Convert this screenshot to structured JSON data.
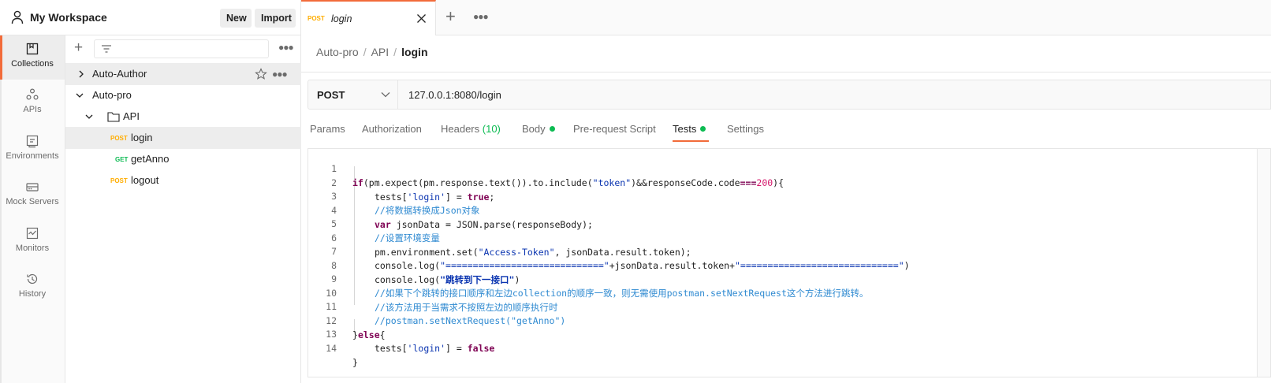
{
  "workspace": {
    "title": "My Workspace",
    "new_label": "New",
    "import_label": "Import",
    "user_icon": "person-icon"
  },
  "sidebar": {
    "items": [
      {
        "label": "Collections",
        "icon": "collections-icon",
        "active": true
      },
      {
        "label": "APIs",
        "icon": "apis-icon",
        "active": false
      },
      {
        "label": "Environments",
        "icon": "environments-icon",
        "active": false
      },
      {
        "label": "Mock Servers",
        "icon": "mock-servers-icon",
        "active": false
      },
      {
        "label": "Monitors",
        "icon": "monitors-icon",
        "active": false
      },
      {
        "label": "History",
        "icon": "history-icon",
        "active": false
      }
    ]
  },
  "collections": {
    "tree": [
      {
        "label": "Auto-Author",
        "kind": "collection",
        "expanded": false
      },
      {
        "label": "Auto-pro",
        "kind": "collection",
        "expanded": true
      },
      {
        "label": "API",
        "kind": "folder",
        "expanded": true
      },
      {
        "label": "login",
        "kind": "request",
        "method": "POST",
        "selected": true
      },
      {
        "label": "getAnno",
        "kind": "request",
        "method": "GET"
      },
      {
        "label": "logout",
        "kind": "request",
        "method": "POST"
      }
    ]
  },
  "tab": {
    "method": "POST",
    "title": "login"
  },
  "breadcrumb": {
    "items": [
      "Auto-pro",
      "API",
      "login"
    ],
    "separator": "/"
  },
  "request": {
    "method": "POST",
    "url": "127.0.0.1:8080/login"
  },
  "request_tabs": [
    {
      "label": "Params"
    },
    {
      "label": "Authorization"
    },
    {
      "label": "Headers",
      "count": "(10)"
    },
    {
      "label": "Body",
      "dot": true
    },
    {
      "label": "Pre-request Script"
    },
    {
      "label": "Tests",
      "dot": true,
      "active": true
    },
    {
      "label": "Settings"
    }
  ],
  "editor": {
    "lines": [
      "1",
      "2",
      "3",
      "4",
      "5",
      "6",
      "7",
      "8",
      "9",
      "10",
      "11",
      "12",
      "13",
      "14"
    ],
    "code": {
      "l1_a": "if",
      "l1_b": "(pm.expect(pm.response.text()).to.include(",
      "l1_c": "\"token\"",
      "l1_d": ")&&responseCode.code",
      "l1_e": "===",
      "l1_f": "200",
      "l1_g": "){",
      "l2_a": "tests[",
      "l2_b": "'login'",
      "l2_c": "] = ",
      "l2_d": "true",
      "l2_e": ";",
      "l3": "//将数据转换成Json对象",
      "l4_a": "var",
      "l4_b": " jsonData = JSON.parse(responseBody);",
      "l5": "//设置环境变量",
      "l6_a": "pm.environment.set(",
      "l6_b": "\"Access-Token\"",
      "l6_c": ", jsonData.result.token);",
      "l7_a": "console.log(",
      "l7_b": "\"=============================\"",
      "l7_c": "+jsonData.result.token+",
      "l7_d": "\"=============================\"",
      "l7_e": ")",
      "l8_a": "console.log(",
      "l8_b": "\"跳转到下一接口\"",
      "l8_c": ")",
      "l9": "//如果下个跳转的接口顺序和左边collection的顺序一致，则无需使用postman.setNextRequest这个方法进行跳转。",
      "l10": "//该方法用于当需求不按照左边的顺序执行时",
      "l11": "//postman.setNextRequest(\"getAnno\")",
      "l12_a": "}",
      "l12_b": "else",
      "l12_c": "{",
      "l13_a": "tests[",
      "l13_b": "'login'",
      "l13_c": "] = ",
      "l13_d": "false",
      "l14": "}"
    }
  },
  "colors": {
    "accent": "#f26b3a",
    "post": "#ffad00",
    "get": "#0cbb52",
    "status_dot": "#0cbb52"
  }
}
